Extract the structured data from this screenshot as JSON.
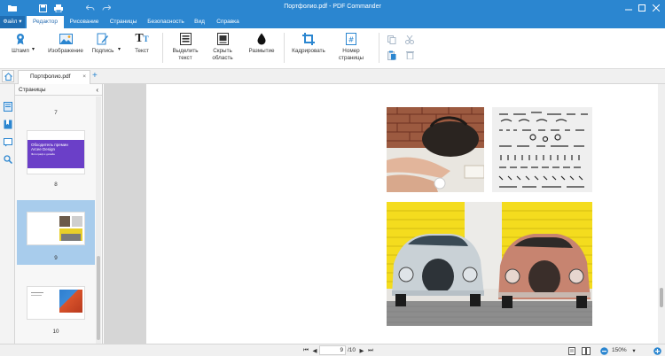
{
  "window": {
    "title": "Портфолио.pdf - PDF Commander"
  },
  "menubar": {
    "items": [
      {
        "label": "Файл"
      },
      {
        "label": "Редактор"
      },
      {
        "label": "Рисование"
      },
      {
        "label": "Страницы"
      },
      {
        "label": "Безопасность"
      },
      {
        "label": "Вид"
      },
      {
        "label": "Справка"
      }
    ]
  },
  "ribbon": {
    "stamp": "Штамп",
    "image": "Изображение",
    "sign": "Подпись",
    "text": "Текст",
    "highlight": [
      "Выделить",
      "текст"
    ],
    "hide": [
      "Скрыть",
      "область"
    ],
    "blur": "Размытие",
    "crop": "Кадрировать",
    "pagenum": [
      "Номер",
      "страницы"
    ]
  },
  "tabs": {
    "doc": "Портфолио.pdf",
    "close": "×",
    "add": "+"
  },
  "panel": {
    "title": "Страницы",
    "pages": [
      "7",
      "8",
      "9",
      "10"
    ],
    "thumb8": {
      "line1": "Обходитель премии",
      "line2": "Arcee Design",
      "line3": "Фотограф и дизайн"
    }
  },
  "statusbar": {
    "page_current": "9",
    "page_total": "/10",
    "zoom": "150%"
  },
  "colors": {
    "accent": "#2b86d0",
    "selection": "#a8ccec",
    "thumb_purple": "#6b3fc8"
  }
}
